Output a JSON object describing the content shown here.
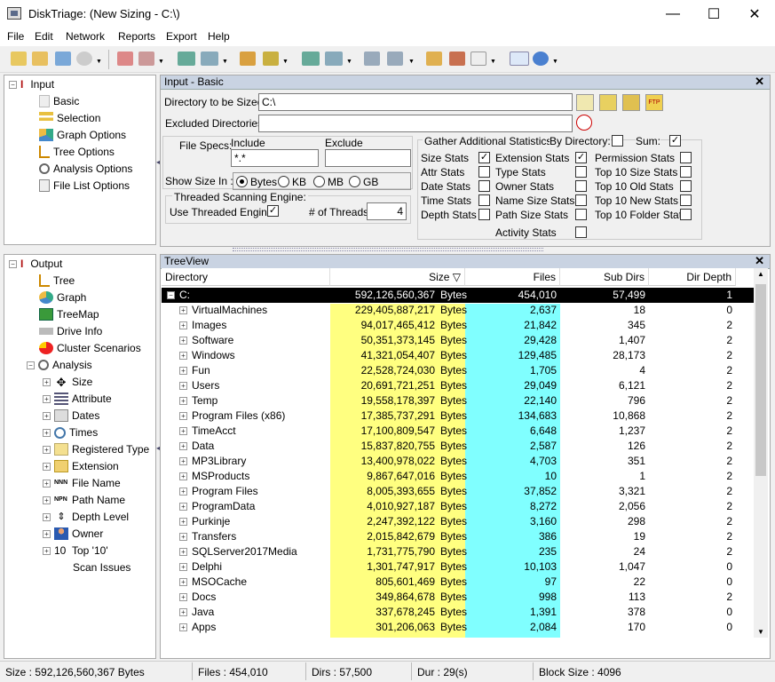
{
  "window": {
    "title": "DiskTriage:  (New Sizing - C:\\)",
    "minimize": "—",
    "maximize": "☐",
    "close": "✕"
  },
  "menu": [
    "File",
    "Edit",
    "Network",
    "Reports",
    "Export",
    "Help"
  ],
  "input_tree": {
    "root": "Input",
    "items": [
      "Basic",
      "Selection",
      "Graph Options",
      "Tree Options",
      "Analysis Options",
      "File List Options"
    ]
  },
  "output_tree": {
    "root": "Output",
    "items": [
      "Tree",
      "Graph",
      "TreeMap",
      "Drive Info",
      "Cluster Scenarios"
    ],
    "analysis": "Analysis",
    "analysis_items": [
      "Size",
      "Attribute",
      "Dates",
      "Times",
      "Registered Type",
      "Extension",
      "File Name",
      "Path Name",
      "Depth Level",
      "Owner",
      "Top '10'"
    ],
    "scan_issues": "Scan Issues"
  },
  "basic": {
    "header": "Input - Basic",
    "close": "✕",
    "dir_label": "Directory to be Sized:",
    "dir_value": "C:\\",
    "excl_label": "Excluded Directories:",
    "excl_value": "",
    "filespecs_label": "File Specs:",
    "include_label": "Include",
    "exclude_label": "Exclude",
    "include_value": "*.*",
    "exclude_value": "",
    "showsize_label": "Show Size In :",
    "units": [
      "Bytes",
      "KB",
      "MB",
      "GB"
    ],
    "threaded_group": "Threaded Scanning Engine:",
    "use_threaded": "Use Threaded Engine",
    "threads_label": "# of Threads",
    "threads_value": "4",
    "gather_label": "Gather Additional Statistics:",
    "bydir_label": "By Directory:",
    "sum_label": "Sum:",
    "stats_col1": [
      "Size Stats",
      "Attr Stats",
      "Date Stats",
      "Time Stats",
      "Depth Stats"
    ],
    "stats_col2": [
      "Extension Stats",
      "Type Stats",
      "Owner Stats",
      "Name Size Stats",
      "Path Size Stats"
    ],
    "stats_col3": [
      "Permission Stats",
      "Top 10 Size Stats",
      "Top 10 Old Stats",
      "Top 10 New Stats",
      "Top 10 Folder Stats"
    ],
    "activity": "Activity Stats",
    "check_mark": "✓"
  },
  "treeview": {
    "header": "TreeView",
    "close": "✕",
    "columns": {
      "directory": "Directory",
      "size": "Size ▽",
      "files": "Files",
      "subdirs": "Sub Dirs",
      "depth": "Dir Depth"
    },
    "unit": "Bytes",
    "root": {
      "name": "C:",
      "size": "592,126,560,367",
      "files": "454,010",
      "subdirs": "57,499",
      "depth": "1"
    },
    "rows": [
      {
        "name": "VirtualMachines",
        "size": "229,405,887,217",
        "files": "2,637",
        "subdirs": "18",
        "depth": "0"
      },
      {
        "name": "Images",
        "size": "94,017,465,412",
        "files": "21,842",
        "subdirs": "345",
        "depth": "2"
      },
      {
        "name": "Software",
        "size": "50,351,373,145",
        "files": "29,428",
        "subdirs": "1,407",
        "depth": "2"
      },
      {
        "name": "Windows",
        "size": "41,321,054,407",
        "files": "129,485",
        "subdirs": "28,173",
        "depth": "2"
      },
      {
        "name": "Fun",
        "size": "22,528,724,030",
        "files": "1,705",
        "subdirs": "4",
        "depth": "2"
      },
      {
        "name": "Users",
        "size": "20,691,721,251",
        "files": "29,049",
        "subdirs": "6,121",
        "depth": "2"
      },
      {
        "name": "Temp",
        "size": "19,558,178,397",
        "files": "22,140",
        "subdirs": "796",
        "depth": "2"
      },
      {
        "name": "Program Files (x86)",
        "size": "17,385,737,291",
        "files": "134,683",
        "subdirs": "10,868",
        "depth": "2"
      },
      {
        "name": "TimeAcct",
        "size": "17,100,809,547",
        "files": "6,648",
        "subdirs": "1,237",
        "depth": "2"
      },
      {
        "name": "Data",
        "size": "15,837,820,755",
        "files": "2,587",
        "subdirs": "126",
        "depth": "2"
      },
      {
        "name": "MP3Library",
        "size": "13,400,978,022",
        "files": "4,703",
        "subdirs": "351",
        "depth": "2"
      },
      {
        "name": "MSProducts",
        "size": "9,867,647,016",
        "files": "10",
        "subdirs": "1",
        "depth": "2"
      },
      {
        "name": "Program Files",
        "size": "8,005,393,655",
        "files": "37,852",
        "subdirs": "3,321",
        "depth": "2"
      },
      {
        "name": "ProgramData",
        "size": "4,010,927,187",
        "files": "8,272",
        "subdirs": "2,056",
        "depth": "2"
      },
      {
        "name": "Purkinje",
        "size": "2,247,392,122",
        "files": "3,160",
        "subdirs": "298",
        "depth": "2"
      },
      {
        "name": "Transfers",
        "size": "2,015,842,679",
        "files": "386",
        "subdirs": "19",
        "depth": "2"
      },
      {
        "name": "SQLServer2017Media",
        "size": "1,731,775,790",
        "files": "235",
        "subdirs": "24",
        "depth": "2"
      },
      {
        "name": "Delphi",
        "size": "1,301,747,917",
        "files": "10,103",
        "subdirs": "1,047",
        "depth": "0"
      },
      {
        "name": "MSOCache",
        "size": "805,601,469",
        "files": "97",
        "subdirs": "22",
        "depth": "0"
      },
      {
        "name": "Docs",
        "size": "349,864,678",
        "files": "998",
        "subdirs": "113",
        "depth": "2"
      },
      {
        "name": "Java",
        "size": "337,678,245",
        "files": "1,391",
        "subdirs": "378",
        "depth": "0"
      },
      {
        "name": "Apps",
        "size": "301,206,063",
        "files": "2,084",
        "subdirs": "170",
        "depth": "0"
      }
    ]
  },
  "status": {
    "size": "Size :   592,126,560,367  Bytes",
    "files": "Files :   454,010",
    "dirs": "Dirs :   57,500",
    "dur": "Dur :   29(s)",
    "block": "Block Size :  4096"
  }
}
